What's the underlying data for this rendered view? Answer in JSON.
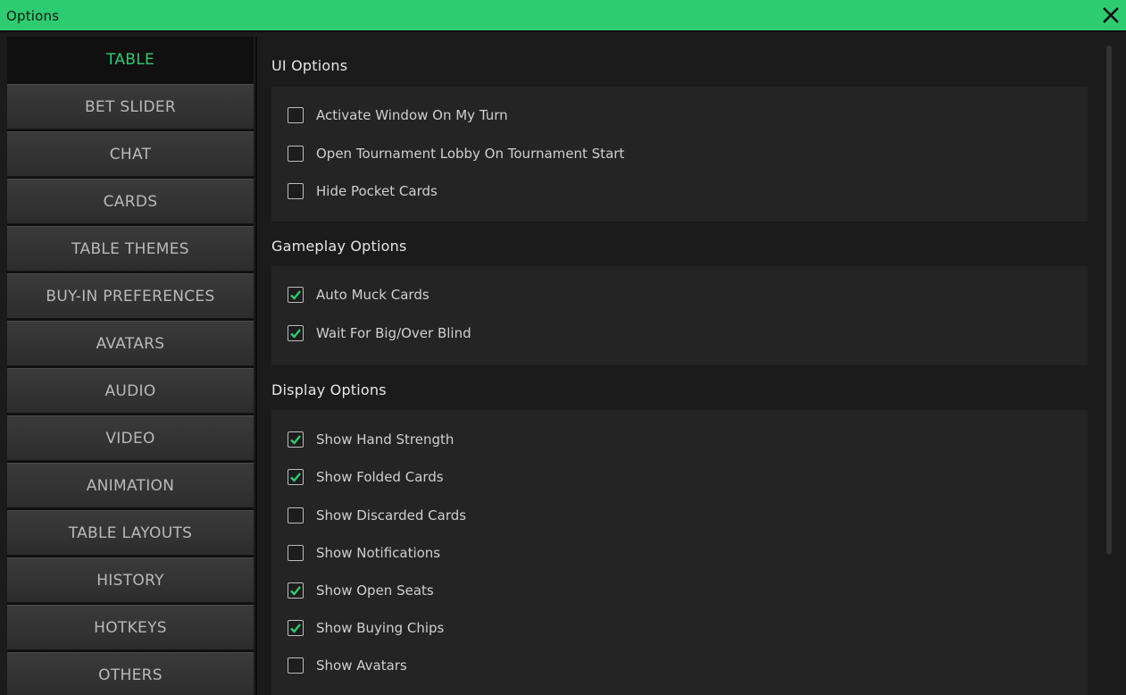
{
  "window": {
    "title": "Options",
    "accent": "#2ecc71"
  },
  "sidebar": {
    "items": [
      {
        "label": "TABLE",
        "active": true
      },
      {
        "label": "BET SLIDER",
        "active": false
      },
      {
        "label": "CHAT",
        "active": false
      },
      {
        "label": "CARDS",
        "active": false
      },
      {
        "label": "TABLE THEMES",
        "active": false
      },
      {
        "label": "BUY-IN PREFERENCES",
        "active": false
      },
      {
        "label": "AVATARS",
        "active": false
      },
      {
        "label": "AUDIO",
        "active": false
      },
      {
        "label": "VIDEO",
        "active": false
      },
      {
        "label": "ANIMATION",
        "active": false
      },
      {
        "label": "TABLE LAYOUTS",
        "active": false
      },
      {
        "label": "HISTORY",
        "active": false
      },
      {
        "label": "HOTKEYS",
        "active": false
      },
      {
        "label": "OTHERS",
        "active": false
      }
    ]
  },
  "sections": [
    {
      "title": "UI Options",
      "options": [
        {
          "label": "Activate Window On My Turn",
          "checked": false
        },
        {
          "label": "Open Tournament Lobby On Tournament Start",
          "checked": false
        },
        {
          "label": "Hide Pocket Cards",
          "checked": false
        }
      ]
    },
    {
      "title": "Gameplay Options",
      "options": [
        {
          "label": "Auto Muck Cards",
          "checked": true
        },
        {
          "label": "Wait For Big/Over Blind",
          "checked": true
        }
      ]
    },
    {
      "title": "Display Options",
      "options": [
        {
          "label": "Show Hand Strength",
          "checked": true
        },
        {
          "label": "Show Folded Cards",
          "checked": true
        },
        {
          "label": "Show Discarded Cards",
          "checked": false
        },
        {
          "label": "Show Notifications",
          "checked": false
        },
        {
          "label": "Show Open Seats",
          "checked": true
        },
        {
          "label": "Show Buying Chips",
          "checked": true
        },
        {
          "label": "Show Avatars",
          "checked": false
        }
      ]
    }
  ]
}
